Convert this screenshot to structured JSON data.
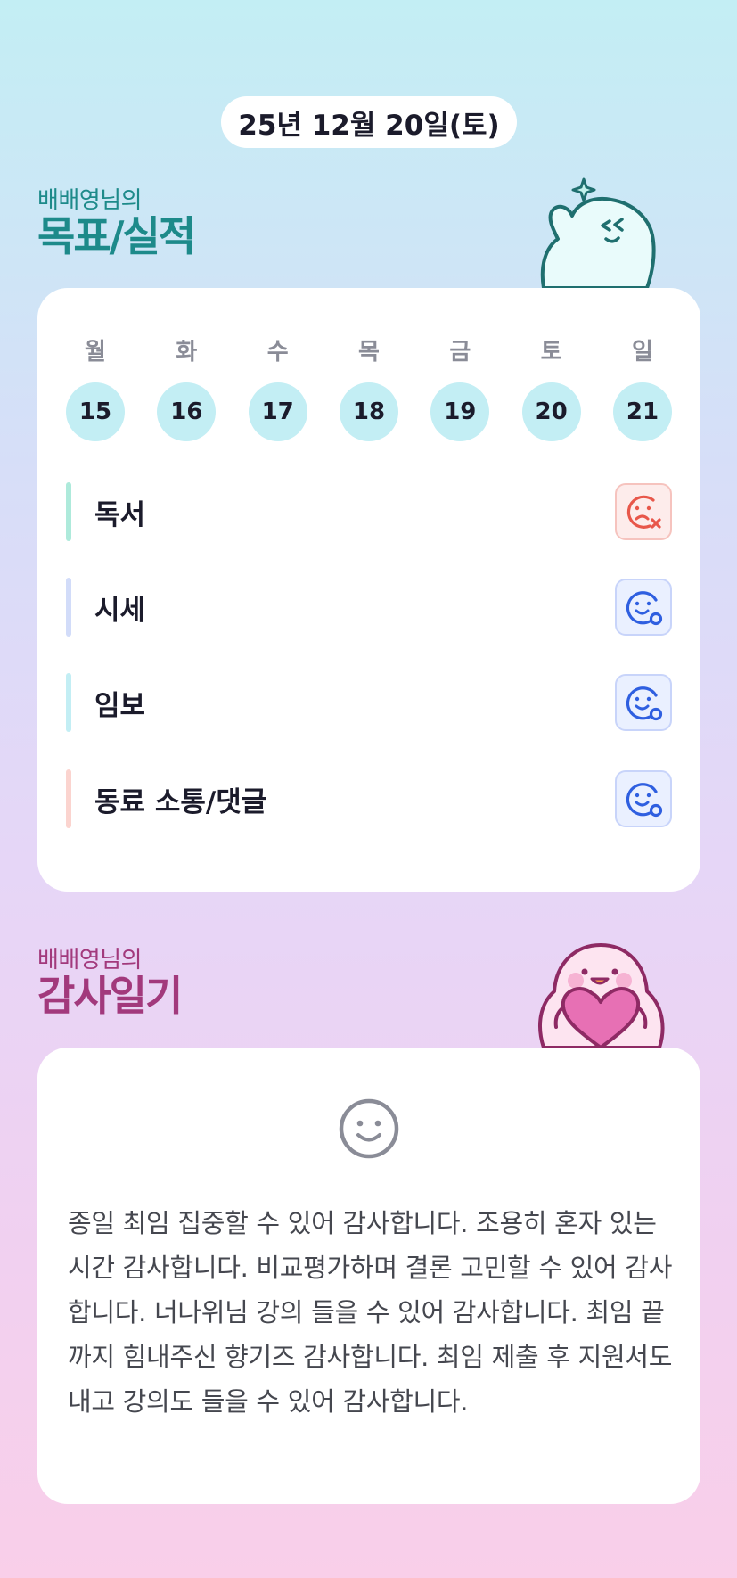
{
  "header": {
    "date": "25년 12월 20일(토)"
  },
  "goals_section": {
    "user_line": "배배영님의",
    "title": "목표/실적"
  },
  "week": {
    "days": [
      {
        "label": "월",
        "num": "15"
      },
      {
        "label": "화",
        "num": "16"
      },
      {
        "label": "수",
        "num": "17"
      },
      {
        "label": "목",
        "num": "18"
      },
      {
        "label": "금",
        "num": "19"
      },
      {
        "label": "토",
        "num": "20"
      },
      {
        "label": "일",
        "num": "21"
      }
    ]
  },
  "goals": [
    {
      "label": "독서",
      "status": "fail",
      "bar_color": "#aeeadb",
      "icon": "sad-face-x-icon"
    },
    {
      "label": "시세",
      "status": "done",
      "bar_color": "#d2dcf9",
      "icon": "smile-face-check-icon"
    },
    {
      "label": "임보",
      "status": "done",
      "bar_color": "#c3eef4",
      "icon": "smile-face-check-icon"
    },
    {
      "label": "동료 소통/댓글",
      "status": "done",
      "bar_color": "#fbd4cf",
      "icon": "smile-face-check-icon"
    }
  ],
  "thanks_section": {
    "user_line": "배배영님의",
    "title": "감사일기"
  },
  "thanks": {
    "icon": "smile-face-icon",
    "text": "종일 최임 집중할 수 있어 감사합니다. 조용히 혼자 있는 시간 감사합니다. 비교평가하며 결론 고민할 수 있어 감사합니다. 너나위님 강의 들을 수 있어 감사합니다. 최임 끝까지 힘내주신 향기즈 감사합니다. 최임 제출 후 지원서도 내고 강의도 들을 수 있어 감사합니다."
  },
  "colors": {
    "teal_title": "#1d8a8a",
    "magenta_title": "#a2397c",
    "day_circle": "#c3eef4",
    "fail": "#e8574a",
    "done": "#2f5fe0"
  }
}
